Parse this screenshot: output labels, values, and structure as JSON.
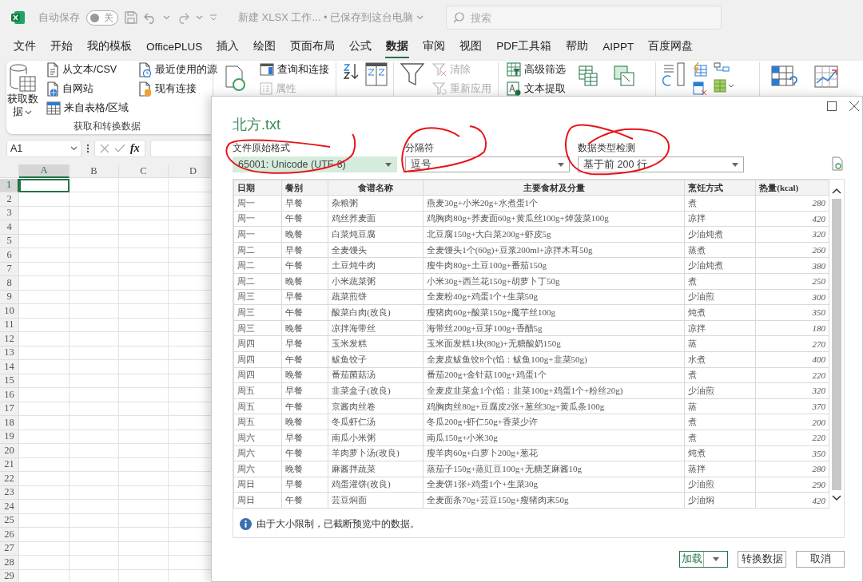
{
  "title_bar": {
    "autosave": {
      "label": "自动保存",
      "on": false,
      "state_text": "关"
    },
    "document_title": "新建 XLSX 工作... • 已保存到这台电脑",
    "search": {
      "placeholder": "搜索"
    }
  },
  "menu_tabs": [
    {
      "label": "文件",
      "selected": false
    },
    {
      "label": "开始",
      "selected": false
    },
    {
      "label": "我的模板",
      "selected": false
    },
    {
      "label": "OfficePLUS",
      "selected": false
    },
    {
      "label": "插入",
      "selected": false
    },
    {
      "label": "绘图",
      "selected": false
    },
    {
      "label": "页面布局",
      "selected": false
    },
    {
      "label": "公式",
      "selected": false
    },
    {
      "label": "数据",
      "selected": true
    },
    {
      "label": "审阅",
      "selected": false
    },
    {
      "label": "视图",
      "selected": false
    },
    {
      "label": "PDF工具箱",
      "selected": false
    },
    {
      "label": "帮助",
      "selected": false
    },
    {
      "label": "AIPPT",
      "selected": false
    },
    {
      "label": "百度网盘",
      "selected": false
    }
  ],
  "ribbon": {
    "get_data_button": "获取数据",
    "source_buttons": [
      {
        "label": "从文本/CSV",
        "disabled": false
      },
      {
        "label": "自网站",
        "disabled": false
      },
      {
        "label": "来自表格/区域",
        "disabled": false
      }
    ],
    "recent_buttons": [
      {
        "label": "最近使用的源",
        "disabled": false
      },
      {
        "label": "现有连接",
        "disabled": false
      }
    ],
    "group_label": "获取和转换数据",
    "query_buttons": [
      {
        "label": "查询和连接",
        "disabled": false
      },
      {
        "label": "属性",
        "disabled": true
      }
    ],
    "filter_buttons": [
      {
        "label": "清除",
        "disabled": true
      },
      {
        "label": "重新应用",
        "disabled": true
      }
    ],
    "tool_buttons": [
      {
        "label": "高级筛选",
        "disabled": false
      },
      {
        "label": "文本提取",
        "disabled": false
      }
    ]
  },
  "formula_bar": {
    "name_box": "A1",
    "function_label": "fx"
  },
  "sheet": {
    "columns": [
      {
        "label": "A",
        "selected": true
      },
      {
        "label": "B",
        "selected": false
      },
      {
        "label": "C",
        "selected": false
      },
      {
        "label": "D",
        "selected": false
      }
    ],
    "rows": [
      {
        "label": "1",
        "selected": true
      },
      {
        "label": "2",
        "selected": false
      },
      {
        "label": "3",
        "selected": false
      },
      {
        "label": "4",
        "selected": false
      },
      {
        "label": "5",
        "selected": false
      },
      {
        "label": "6",
        "selected": false
      },
      {
        "label": "7",
        "selected": false
      },
      {
        "label": "8",
        "selected": false
      },
      {
        "label": "9",
        "selected": false
      },
      {
        "label": "10",
        "selected": false
      },
      {
        "label": "11",
        "selected": false
      },
      {
        "label": "12",
        "selected": false
      },
      {
        "label": "13",
        "selected": false
      },
      {
        "label": "14",
        "selected": false
      },
      {
        "label": "15",
        "selected": false
      },
      {
        "label": "16",
        "selected": false
      },
      {
        "label": "17",
        "selected": false
      },
      {
        "label": "18",
        "selected": false
      },
      {
        "label": "19",
        "selected": false
      },
      {
        "label": "20",
        "selected": false
      },
      {
        "label": "21",
        "selected": false
      },
      {
        "label": "22",
        "selected": false
      },
      {
        "label": "23",
        "selected": false
      },
      {
        "label": "24",
        "selected": false
      },
      {
        "label": "25",
        "selected": false
      },
      {
        "label": "26",
        "selected": false
      },
      {
        "label": "27",
        "selected": false
      },
      {
        "label": "28",
        "selected": false
      },
      {
        "label": "29",
        "selected": false
      }
    ]
  },
  "dialog": {
    "title": "北方.txt",
    "fields": [
      {
        "label": "文件原始格式",
        "value": "65001: Unicode (UTF-8)",
        "focused": true
      },
      {
        "label": "分隔符",
        "value": "逗号",
        "focused": false
      },
      {
        "label": "数据类型检测",
        "value": "基于前 200 行",
        "focused": false
      }
    ],
    "preview": {
      "columns": [
        "日期",
        "餐别",
        "食谱名称",
        "主要食材及分量",
        "烹饪方式",
        "热量(kcal)"
      ],
      "rows": [
        [
          "周一",
          "早餐",
          "杂粮粥",
          "燕麦30g+小米20g+水煮蛋1个",
          "煮",
          "280"
        ],
        [
          "周一",
          "午餐",
          "鸡丝荞麦面",
          "鸡胸肉80g+荞麦面60g+黄瓜丝100g+焯菠菜100g",
          "凉拌",
          "420"
        ],
        [
          "周一",
          "晚餐",
          "白菜炖豆腐",
          "北豆腐150g+大白菜200g+虾皮5g",
          "少油炖煮",
          "320"
        ],
        [
          "周二",
          "早餐",
          "全麦馒头",
          "全麦馒头1个(60g)+豆浆200ml+凉拌木耳50g",
          "蒸煮",
          "260"
        ],
        [
          "周二",
          "午餐",
          "土豆炖牛肉",
          "瘦牛肉80g+土豆100g+番茄150g",
          "少油炖煮",
          "380"
        ],
        [
          "周二",
          "晚餐",
          "小米蔬菜粥",
          "小米30g+西兰花150g+胡萝卜丁50g",
          "煮",
          "250"
        ],
        [
          "周三",
          "早餐",
          "蔬菜煎饼",
          "全麦粉40g+鸡蛋1个+生菜50g",
          "少油煎",
          "300"
        ],
        [
          "周三",
          "午餐",
          "酸菜白肉(改良)",
          "瘦猪肉60g+酸菜150g+魔芋丝100g",
          "炖煮",
          "350"
        ],
        [
          "周三",
          "晚餐",
          "凉拌海带丝",
          "海带丝200g+豆芽100g+香醋5g",
          "凉拌",
          "180"
        ],
        [
          "周四",
          "早餐",
          "玉米发糕",
          "玉米面发糕1块(80g)+无糖酸奶150g",
          "蒸",
          "270"
        ],
        [
          "周四",
          "午餐",
          "鲅鱼饺子",
          "全麦皮鲅鱼饺8个(馅：鲅鱼100g+韭菜50g)",
          "水煮",
          "400"
        ],
        [
          "周四",
          "晚餐",
          "番茄菌菇汤",
          "番茄200g+金针菇100g+鸡蛋1个",
          "煮",
          "220"
        ],
        [
          "周五",
          "早餐",
          "韭菜盒子(改良)",
          "全麦皮韭菜盒1个(馅：韭菜100g+鸡蛋1个+粉丝20g)",
          "少油煎",
          "320"
        ],
        [
          "周五",
          "午餐",
          "京酱肉丝卷",
          "鸡胸肉丝80g+豆腐皮2张+葱丝30g+黄瓜条100g",
          "蒸",
          "370"
        ],
        [
          "周五",
          "晚餐",
          "冬瓜虾仁汤",
          "冬瓜200g+虾仁50g+香菜少许",
          "煮",
          "200"
        ],
        [
          "周六",
          "早餐",
          "南瓜小米粥",
          "南瓜150g+小米30g",
          "煮",
          "220"
        ],
        [
          "周六",
          "午餐",
          "羊肉萝卜汤(改良)",
          "瘦羊肉60g+白萝卜200g+葱花",
          "炖煮",
          "350"
        ],
        [
          "周六",
          "晚餐",
          "麻酱拌蔬菜",
          "蒸茄子150g+蒸豇豆100g+无糖芝麻酱10g",
          "蒸拌",
          "280"
        ],
        [
          "周日",
          "早餐",
          "鸡蛋灌饼(改良)",
          "全麦饼1张+鸡蛋1个+生菜30g",
          "少油煎",
          "290"
        ],
        [
          "周日",
          "午餐",
          "芸豆焖面",
          "全麦面条70g+芸豆150g+瘦猪肉末50g",
          "少油焖",
          "420"
        ]
      ]
    },
    "notice": "由于大小限制，已截断预览中的数据。",
    "buttons": [
      {
        "label": "加载",
        "kind": "split"
      },
      {
        "label": "转换数据",
        "kind": "plain"
      },
      {
        "label": "取消",
        "kind": "plain"
      }
    ]
  }
}
